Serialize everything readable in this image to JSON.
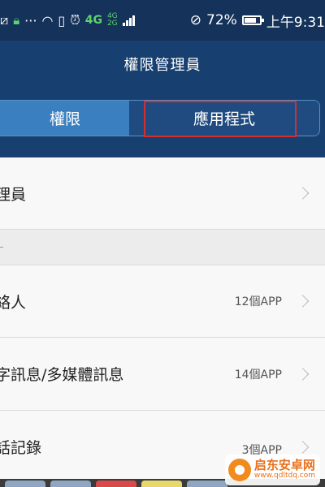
{
  "status_bar": {
    "left_icons": [
      "image-icon",
      "lock-icon",
      "more-icon",
      "headphones-icon",
      "vibrate-icon",
      "alarm-icon"
    ],
    "overflow": "···",
    "network_4g": "4G",
    "network_mini_top": "4G",
    "network_mini_bottom": "2G",
    "battery_percent": "72%",
    "battery_level": 0.72,
    "time": "上午9:31"
  },
  "header": {
    "title": "權限管理員"
  },
  "tabs": [
    {
      "label": "權限",
      "selected": true
    },
    {
      "label": "應用程式",
      "selected": false
    }
  ],
  "list": [
    {
      "label": "理員",
      "count": ""
    },
    {
      "label": "絡人",
      "count": "12個APP"
    },
    {
      "label": "字訊息/多媒體訊息",
      "count": "14個APP"
    },
    {
      "label": "話記錄",
      "count": "3個APP"
    }
  ],
  "watermark": {
    "title": "启东安卓网",
    "url": "www.qdltdq.com"
  },
  "colors": {
    "status_bar": "#15325a",
    "header": "#173f6f",
    "tab_active": "#3a7fc0",
    "tab_inactive": "#1f4b80",
    "highlight": "#d32f2f",
    "network_green": "#5ed36b"
  }
}
